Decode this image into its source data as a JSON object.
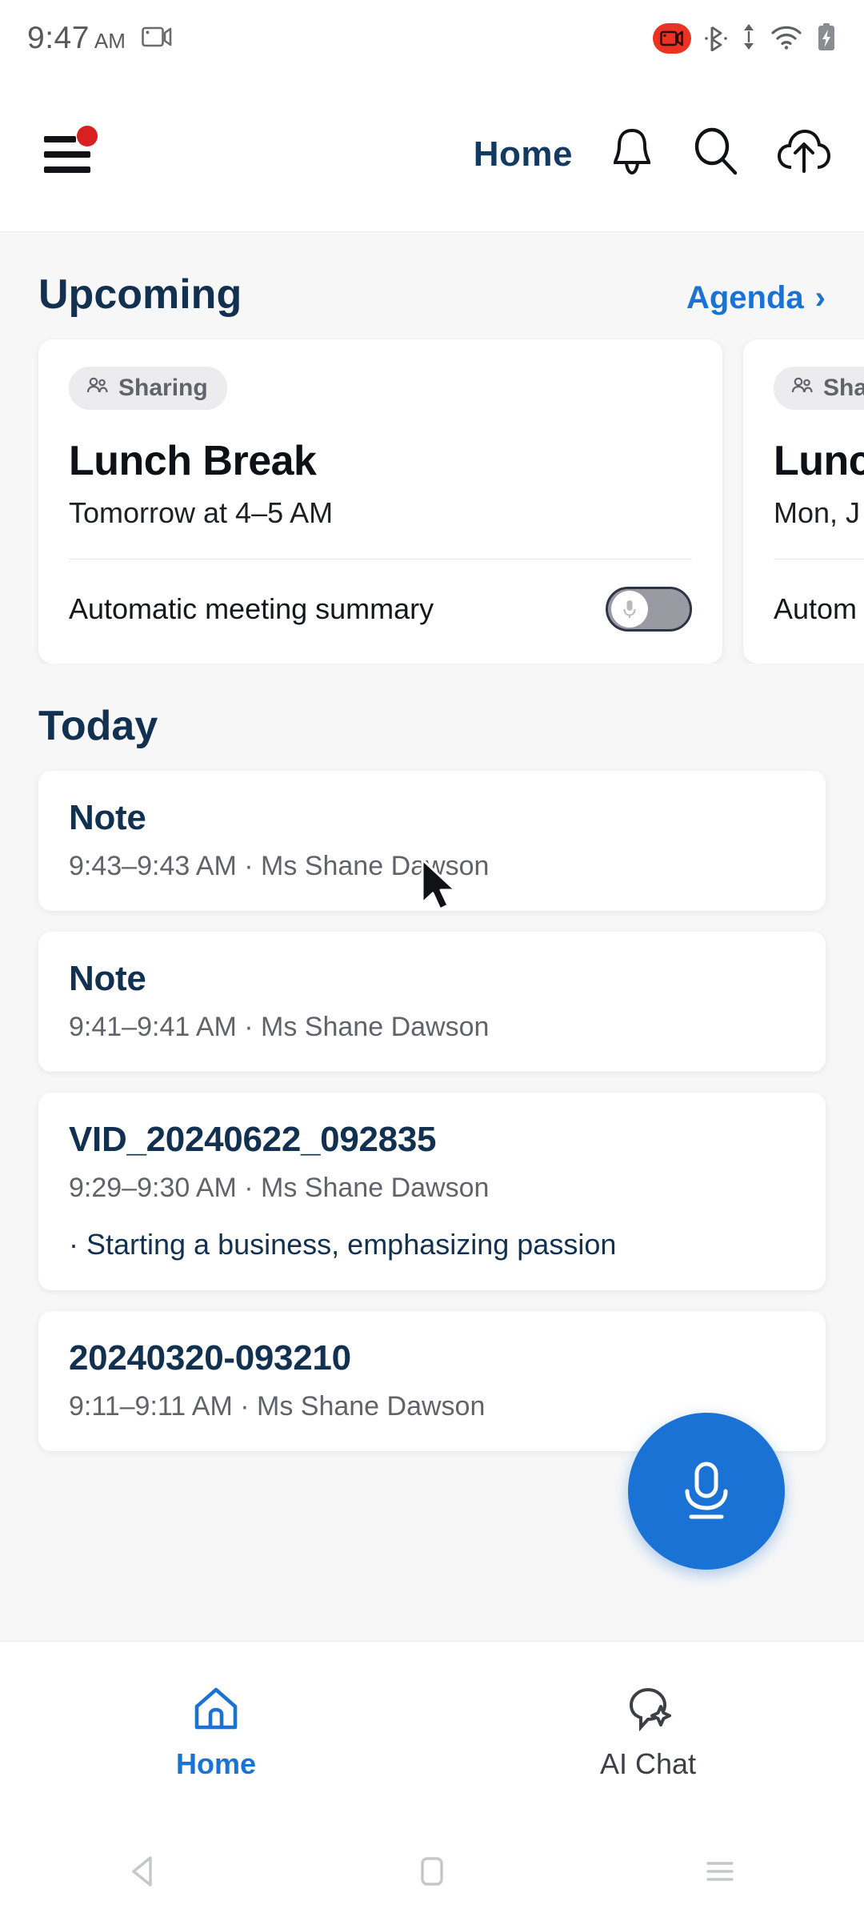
{
  "statusbar": {
    "time": "9:47",
    "ampm": "AM",
    "screen_record_icon": "screen-record-icon",
    "recording_icon": "video-recording-icon",
    "bluetooth_icon": "bluetooth-icon",
    "data_icon": "data-transfer-icon",
    "wifi_icon": "wifi-icon",
    "battery_icon": "battery-charging-icon"
  },
  "appbar": {
    "menu_icon": "hamburger-menu-icon",
    "badge": "notification-badge-dot",
    "title": "Home",
    "bell_icon": "bell-icon",
    "search_icon": "search-icon",
    "upload_icon": "cloud-upload-icon"
  },
  "upcoming": {
    "title": "Upcoming",
    "agenda_label": "Agenda",
    "agenda_chevron": "›",
    "cards": [
      {
        "chip": "Sharing",
        "name": "Lunch Break",
        "time": "Tomorrow at 4–5 AM",
        "summary_label": "Automatic meeting summary",
        "toggle_state": "off"
      },
      {
        "chip": "Sha",
        "name": "Lunc",
        "time": "Mon, J",
        "summary_label": "Autom",
        "toggle_state": "off"
      }
    ]
  },
  "today": {
    "title": "Today",
    "items": [
      {
        "title": "Note",
        "subtitle": "9:43–9:43 AM ·  Ms Shane Dawson",
        "bullet": ""
      },
      {
        "title": "Note",
        "subtitle": "9:41–9:41 AM ·  Ms Shane Dawson",
        "bullet": ""
      },
      {
        "title": "VID_20240622_092835",
        "subtitle": "9:29–9:30 AM ·  Ms Shane Dawson",
        "bullet": "·  Starting a business, emphasizing passion"
      },
      {
        "title": "20240320-093210",
        "subtitle": "9:11–9:11 AM ·  Ms Shane Dawson",
        "bullet": ""
      }
    ]
  },
  "fab": {
    "icon": "microphone-icon"
  },
  "bottomnav": {
    "items": [
      {
        "label": "Home",
        "icon": "home-icon",
        "active": true
      },
      {
        "label": "AI Chat",
        "icon": "ai-chat-icon",
        "active": false
      }
    ]
  },
  "sysnav": {
    "back_icon": "back-triangle-icon",
    "home_icon": "home-square-icon",
    "recents_icon": "recents-lines-icon"
  },
  "colors": {
    "accent_blue": "#1a73d4",
    "title_navy": "#12304f",
    "record_red": "#ea3323",
    "badge_red": "#d82020",
    "page_bg": "#f7f7f8"
  }
}
